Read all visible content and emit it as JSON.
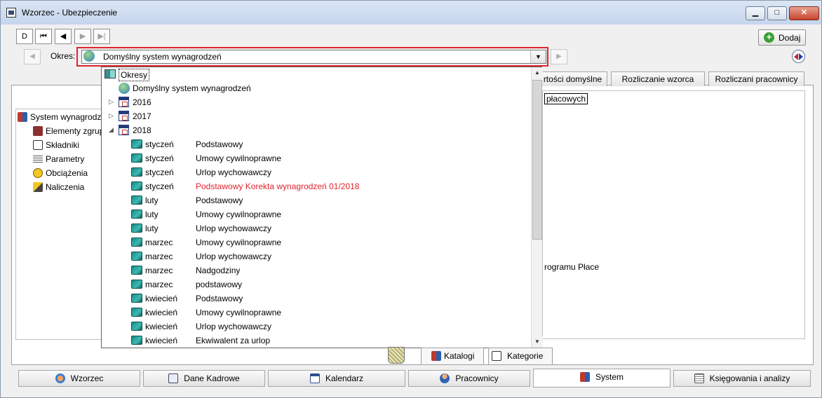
{
  "window": {
    "title": "Wzorzec - Ubezpieczenie",
    "min_glyph": "▁",
    "max_glyph": "□",
    "close_glyph": "✕"
  },
  "toolbar": {
    "nav_new": "D",
    "nav_first": "⏮",
    "nav_prev": "◀",
    "nav_next": "▶",
    "nav_last": "▶|",
    "add_label": "Dodaj",
    "add_glyph": "+"
  },
  "period": {
    "label": "Okres:",
    "selected": "Domyślny system wynagrodzeń",
    "prev_arrow": "◀",
    "next_arrow": "▶",
    "dropdown_arrow": "▼"
  },
  "right_tabs": [
    "rtości domyślne",
    "Rozliczanie wzorca",
    "Rozliczani pracownicy"
  ],
  "right_panel": {
    "header_fragment": "płacowych",
    "line_fragment": "rogramu Płace"
  },
  "left_tree": [
    {
      "label": "System wynagrodz",
      "icon": "system-icon"
    },
    {
      "label": "Elementy zgrup",
      "icon": "group-icon"
    },
    {
      "label": "Składniki",
      "icon": "components-icon"
    },
    {
      "label": "Parametry",
      "icon": "parameters-icon"
    },
    {
      "label": "Obciążenia",
      "icon": "charges-icon"
    },
    {
      "label": "Naliczenia",
      "icon": "accruals-icon"
    }
  ],
  "dropdown": {
    "root": "Okresy",
    "default_system": "Domyślny system wynagrodzeń",
    "years": [
      "2016",
      "2017",
      "2018"
    ],
    "rows": [
      {
        "month": "styczeń",
        "desc": "Podstawowy",
        "highlight": false
      },
      {
        "month": "styczeń",
        "desc": "Umowy cywilnoprawne",
        "highlight": false
      },
      {
        "month": "styczeń",
        "desc": "Urlop wychowawczy",
        "highlight": false
      },
      {
        "month": "styczeń",
        "desc": "Podstawowy Korekta wynagrodzeń 01/2018",
        "highlight": true
      },
      {
        "month": "luty",
        "desc": "Podstawowy",
        "highlight": false
      },
      {
        "month": "luty",
        "desc": "Umowy cywilnoprawne",
        "highlight": false
      },
      {
        "month": "luty",
        "desc": "Urlop wychowawczy",
        "highlight": false
      },
      {
        "month": "marzec",
        "desc": "Umowy cywilnoprawne",
        "highlight": false
      },
      {
        "month": "marzec",
        "desc": "Urlop wychowawczy",
        "highlight": false
      },
      {
        "month": "marzec",
        "desc": "Nadgodziny",
        "highlight": false
      },
      {
        "month": "marzec",
        "desc": "podstawowy",
        "highlight": false
      },
      {
        "month": "kwiecień",
        "desc": "Podstawowy",
        "highlight": false
      },
      {
        "month": "kwiecień",
        "desc": "Umowy cywilnoprawne",
        "highlight": false
      },
      {
        "month": "kwiecień",
        "desc": "Urlop wychowawczy",
        "highlight": false
      },
      {
        "month": "kwiecień",
        "desc": "Ekwiwalent za urlop",
        "highlight": false
      }
    ],
    "colors": {
      "highlight": "#e0242e"
    }
  },
  "sub_tabs": {
    "katalogi": "Katalogi",
    "kategorie": "Kategorie"
  },
  "bottom_tabs": [
    {
      "label": "Wzorzec",
      "icon": "people-icon"
    },
    {
      "label": "Dane Kadrowe",
      "icon": "id-card-icon"
    },
    {
      "label": "Kalendarz",
      "icon": "calendar-icon"
    },
    {
      "label": "Pracownicy",
      "icon": "person-icon"
    },
    {
      "label": "System",
      "icon": "tree-icon",
      "active": true
    },
    {
      "label": "Księgowania i analizy",
      "icon": "ledger-icon"
    }
  ]
}
